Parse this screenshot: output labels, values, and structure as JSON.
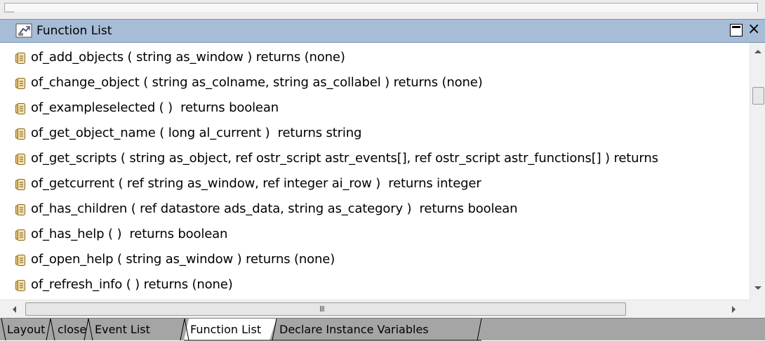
{
  "window": {
    "title": "Function List",
    "max_icon": "maximize-icon",
    "close_glyph": "×"
  },
  "list": {
    "item_icon": "function-script-icon",
    "items": [
      "of_add_objects ( string as_window ) returns (none)",
      "of_change_object ( string as_colname, string as_collabel ) returns (none)",
      "of_exampleselected ( )  returns boolean",
      "of_get_object_name ( long al_current )  returns string",
      "of_get_scripts ( string as_object, ref ostr_script astr_events[], ref ostr_script astr_functions[] ) returns",
      "of_getcurrent ( ref string as_window, ref integer ai_row )  returns integer",
      "of_has_children ( ref datastore ads_data, string as_category )  returns boolean",
      "of_has_help ( )  returns boolean",
      "of_open_help ( string as_window ) returns (none)",
      "of_refresh_info ( ) returns (none)"
    ]
  },
  "hscroll": {
    "grip": "III"
  },
  "tabs": [
    {
      "label": "Layout"
    },
    {
      "label": "close"
    },
    {
      "label": "Event List"
    },
    {
      "label": "Function List"
    },
    {
      "label": "Declare Instance Variables"
    }
  ],
  "active_tab_index": 3,
  "colors": {
    "title_bar": "#a6bcd7",
    "tab_bar": "#a5a5a5",
    "list_bg": "#ffffff"
  }
}
